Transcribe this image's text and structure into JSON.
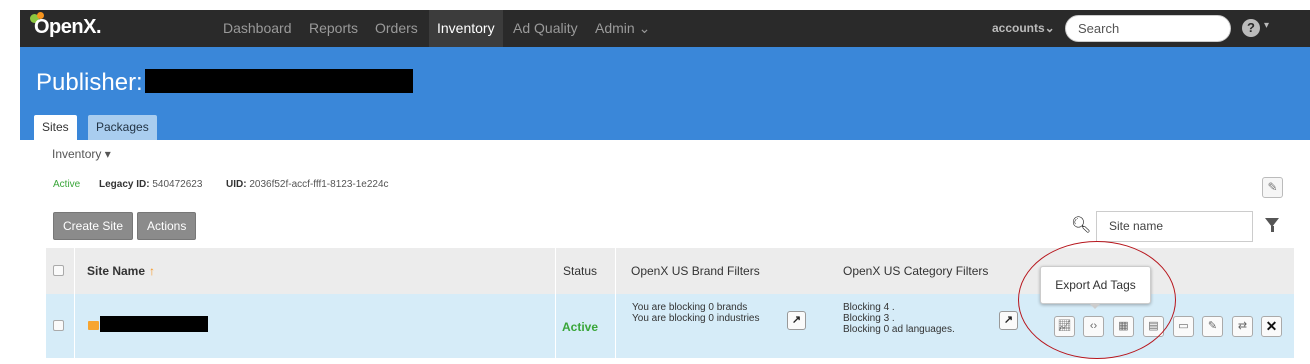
{
  "app": {
    "logo": "OpenX."
  },
  "nav": {
    "items": [
      "Dashboard",
      "Reports",
      "Orders",
      "Inventory",
      "Ad Quality",
      "Admin ⌄"
    ],
    "active": "Inventory",
    "accounts_label": "accounts⌄",
    "search_placeholder": "Search",
    "help": "?",
    "help_caret": "▾"
  },
  "header": {
    "title": "Publisher:",
    "tabs": [
      "Sites",
      "Packages"
    ]
  },
  "subheader": {
    "inventory_dropdown": "Inventory ▾",
    "status": "Active",
    "legacy_label": "Legacy ID:",
    "legacy_value": "540472623",
    "uid_label": "UID:",
    "uid_value": "2036f52f-accf-fff1-8123-1e224c"
  },
  "toolbar": {
    "create_site": "Create Site",
    "actions": "Actions",
    "site_name_placeholder": "Site name"
  },
  "table": {
    "headers": [
      "Site Name",
      "Status",
      "OpenX US Brand Filters",
      "OpenX US Category Filters"
    ],
    "sort_arrow": "↑",
    "rows": [
      {
        "status": "Active",
        "brand_lines": [
          "You are blocking 0 brands",
          "You are blocking 0 industries"
        ],
        "category_lines": [
          "Blocking 4 .",
          "Blocking 3 .",
          "Blocking 0 ad languages."
        ]
      }
    ]
  },
  "tooltip": {
    "text": "Export Ad Tags"
  },
  "colors": {
    "nav_bg": "#2a2a2a",
    "header_blue": "#3a87d9",
    "row_blue": "#d6ecf8",
    "active_green": "#3aa63a",
    "highlight_circle": "#b7161d"
  }
}
